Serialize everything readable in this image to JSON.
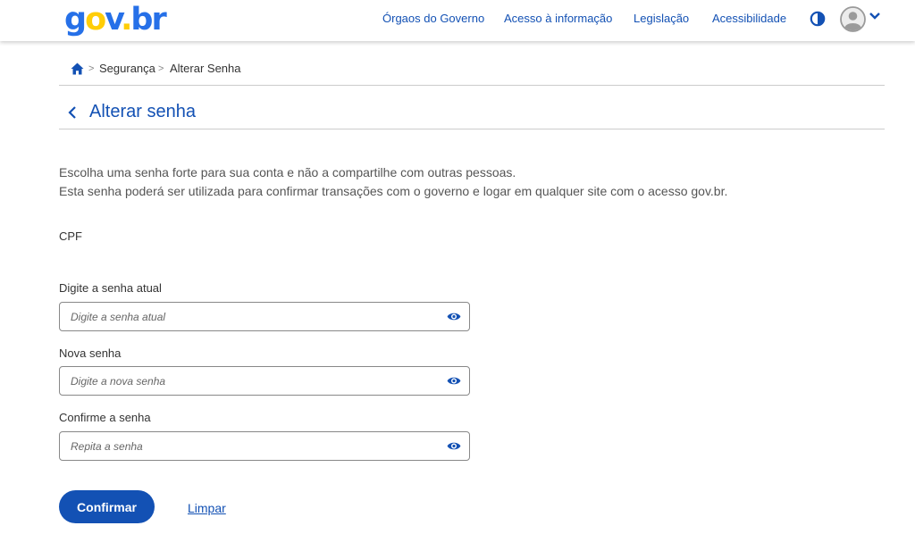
{
  "header": {
    "logo": {
      "g": "g",
      "o": "o",
      "v": "v",
      "dot": ".",
      "b": "b",
      "r": "r"
    },
    "nav": [
      "Órgaos do Governo",
      "Acesso à informação",
      "Legislação",
      "Acessibilidade"
    ],
    "contrast_icon": "contrast-icon",
    "avatar_icon": "user-avatar-icon"
  },
  "breadcrumb": {
    "items": [
      "Segurança",
      "Alterar Senha"
    ],
    "separator": ">"
  },
  "page": {
    "title": "Alterar senha",
    "description": [
      "Escolha uma senha forte para sua conta e não a compartilhe com outras pessoas.",
      "Esta senha poderá ser utilizada para confirmar transações com o governo e logar em qualquer site com o acesso gov.br."
    ],
    "cpf_label": "CPF"
  },
  "form": {
    "fields": [
      {
        "label": "Digite a senha atual",
        "placeholder": "Digite a senha atual",
        "value": ""
      },
      {
        "label": "Nova senha",
        "placeholder": "Digite a nova senha",
        "value": ""
      },
      {
        "label": "Confirme a senha",
        "placeholder": "Repita a senha",
        "value": ""
      }
    ],
    "confirm_label": "Confirmar",
    "clear_label": "Limpar"
  },
  "colors": {
    "primary": "#1351b4",
    "logo_blue": "#2670e8",
    "logo_yellow": "#ffcd07",
    "text": "#333333"
  }
}
